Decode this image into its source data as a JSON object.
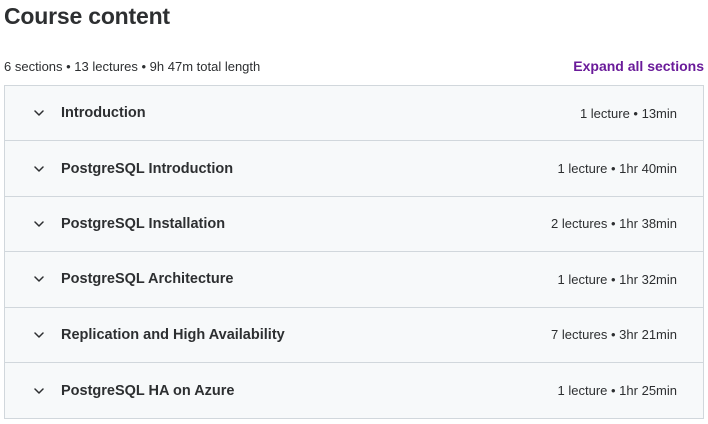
{
  "header": {
    "title": "Course content",
    "summary": "6 sections • 13 lectures • 9h 47m total length",
    "expand_all_label": "Expand all sections"
  },
  "sections": [
    {
      "title": "Introduction",
      "info": "1 lecture • 13min"
    },
    {
      "title": "PostgreSQL Introduction",
      "info": "1 lecture • 1hr 40min"
    },
    {
      "title": "PostgreSQL Installation",
      "info": "2 lectures • 1hr 38min"
    },
    {
      "title": "PostgreSQL Architecture",
      "info": "1 lecture • 1hr 32min"
    },
    {
      "title": "Replication and High Availability",
      "info": "7 lectures • 3hr 21min"
    },
    {
      "title": "PostgreSQL HA on Azure",
      "info": "1 lecture • 1hr 25min"
    }
  ],
  "icons": {
    "section_toggle": "chevron-down-icon"
  },
  "colors": {
    "accent": "#6a1b9a",
    "panel_bg": "#f7f9fa",
    "border": "#d1d7dc",
    "text": "#2d2f31"
  }
}
